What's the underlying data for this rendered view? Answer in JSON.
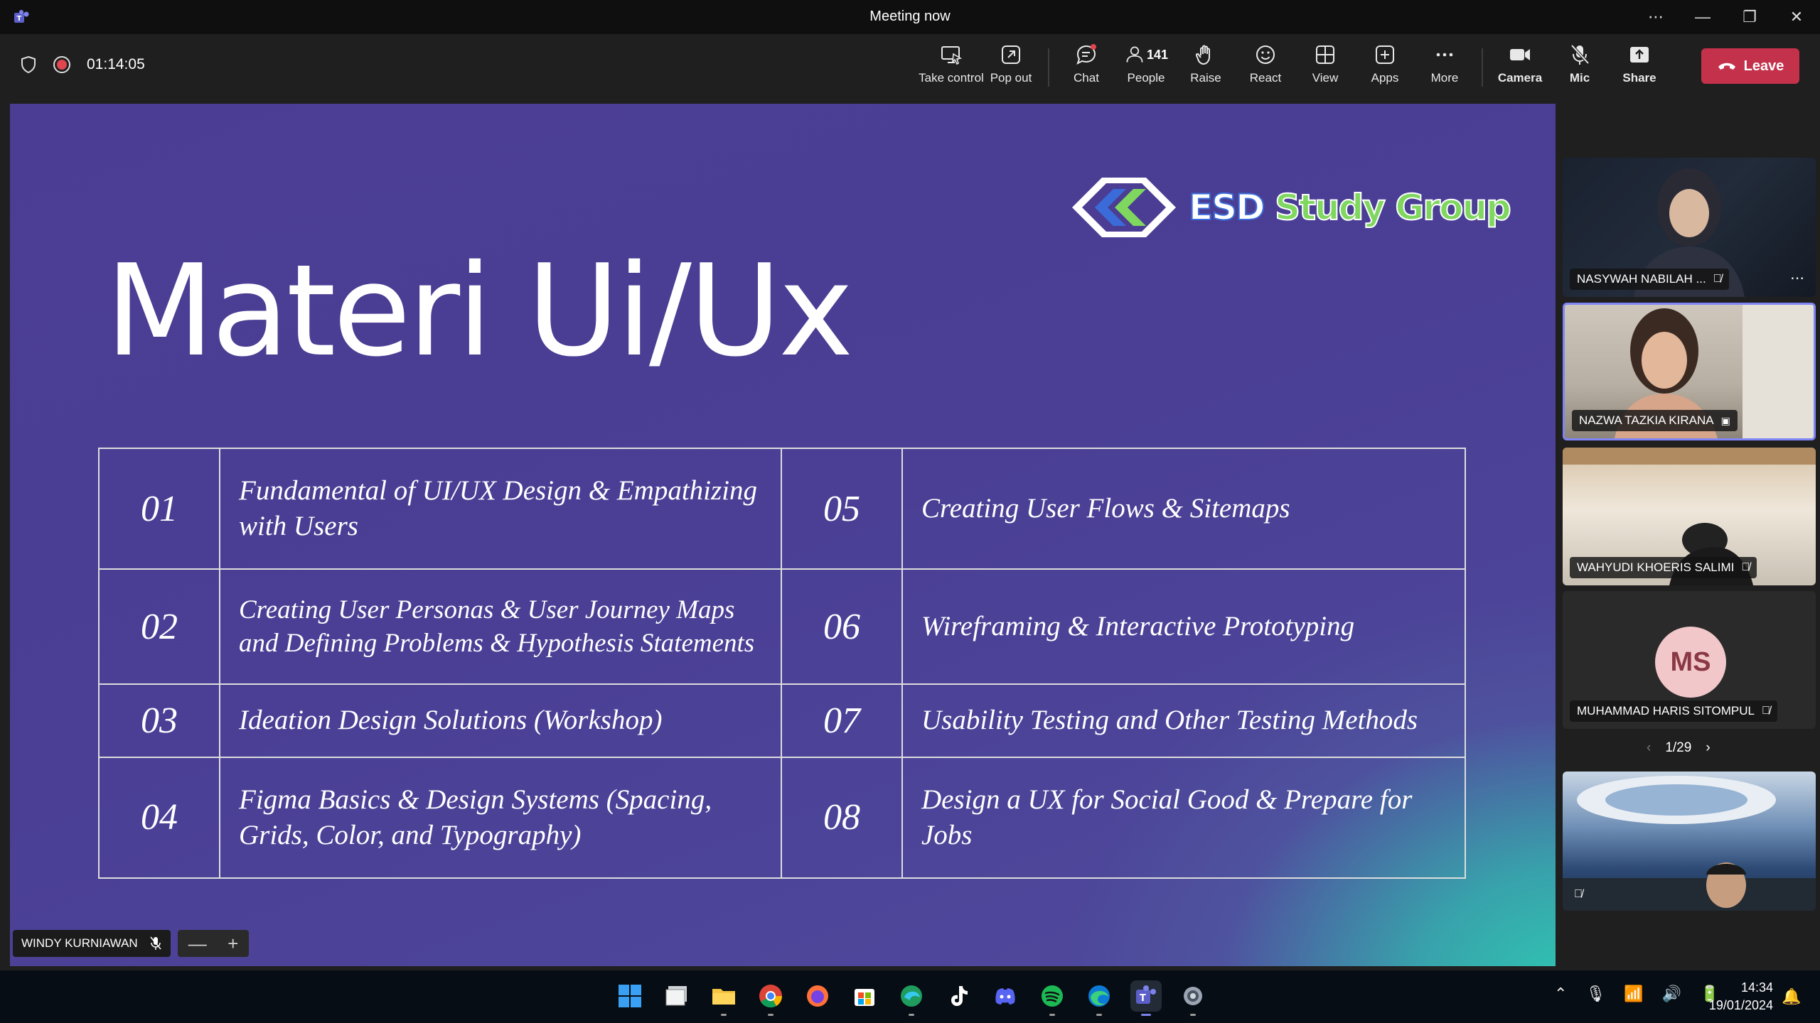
{
  "window": {
    "title": "Meeting now"
  },
  "toolbar": {
    "timer": "01:14:05",
    "people_count": "141",
    "buttons": [
      {
        "label": "Take control",
        "icon": "take-control-icon"
      },
      {
        "label": "Pop out",
        "icon": "pop-out-icon"
      },
      {
        "label": "Chat",
        "icon": "chat-icon"
      },
      {
        "label": "People",
        "icon": "people-icon"
      },
      {
        "label": "Raise",
        "icon": "raise-hand-icon"
      },
      {
        "label": "React",
        "icon": "react-icon"
      },
      {
        "label": "View",
        "icon": "view-icon"
      },
      {
        "label": "Apps",
        "icon": "apps-icon"
      },
      {
        "label": "More",
        "icon": "more-icon"
      },
      {
        "label": "Camera",
        "icon": "camera-icon"
      },
      {
        "label": "Mic",
        "icon": "mic-off-icon"
      },
      {
        "label": "Share",
        "icon": "share-icon"
      }
    ],
    "leave_label": "Leave",
    "leave_color": "#c4314b"
  },
  "slide": {
    "title": "Materi Ui/Ux",
    "logo_part1": "ESD",
    "logo_part2": "Study Group",
    "topics": [
      {
        "num": "01",
        "text": "Fundamental of UI/UX Design & Empathizing with Users"
      },
      {
        "num": "05",
        "text": "Creating User Flows & Sitemaps"
      },
      {
        "num": "02",
        "text": "Creating User Personas & User Journey Maps and Defining Problems & Hypothesis Statements"
      },
      {
        "num": "06",
        "text": "Wireframing & Interactive Prototyping"
      },
      {
        "num": "03",
        "text": "Ideation Design Solutions (Workshop)"
      },
      {
        "num": "07",
        "text": "Usability Testing and Other Testing Methods"
      },
      {
        "num": "04",
        "text": "Figma Basics & Design Systems (Spacing, Grids, Color, and Typography)"
      },
      {
        "num": "08",
        "text": "Design a UX for Social Good & Prepare for Jobs"
      }
    ],
    "presenter": "WINDY KURNIAWAN",
    "zoom_minus": "—",
    "zoom_plus": "+"
  },
  "participants": [
    {
      "name": "NASYWAH NABILAH ..."
    },
    {
      "name": "NAZWA TAZKIA KIRANA"
    },
    {
      "name": "WAHYUDI KHOERIS SALIMI"
    },
    {
      "name": "MUHAMMAD HARIS SITOMPUL",
      "initials": "MS"
    }
  ],
  "pager": {
    "text": "1/29"
  },
  "taskbar": {
    "apps": [
      "start-icon",
      "task-view-icon",
      "file-explorer-icon",
      "chrome-icon",
      "firefox-icon",
      "microsoft-store-icon",
      "edge-dev-icon",
      "tiktok-icon",
      "discord-icon",
      "spotify-icon",
      "edge-icon",
      "teams-icon",
      "settings-icon"
    ],
    "time": "14:34",
    "date": "19/01/2024"
  }
}
